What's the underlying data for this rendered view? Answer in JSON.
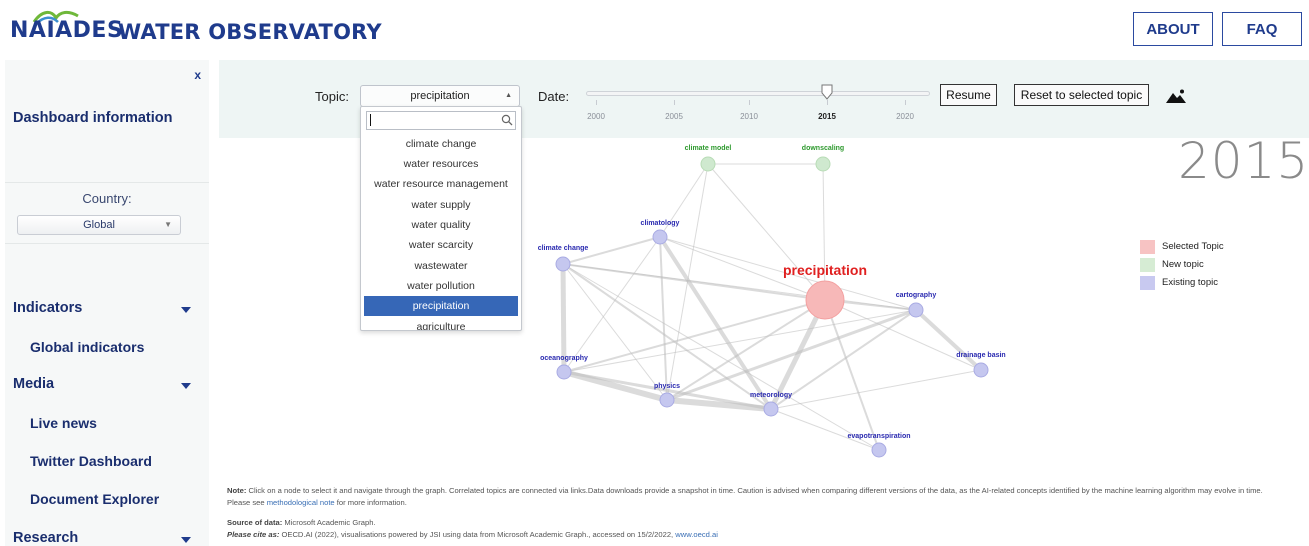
{
  "header": {
    "logo_text": "NAIADES",
    "title": "WATER OBSERVATORY",
    "about_label": "ABOUT",
    "faq_label": "FAQ"
  },
  "sidebar": {
    "close_label": "x",
    "dashboard_info": "Dashboard information",
    "country_label": "Country:",
    "country_value": "Global",
    "sections": [
      {
        "label": "Indicators",
        "items": [
          "Global indicators"
        ]
      },
      {
        "label": "Media",
        "items": [
          "Live news",
          "Twitter Dashboard",
          "Document Explorer"
        ]
      },
      {
        "label": "Research",
        "items": []
      }
    ]
  },
  "controls": {
    "topic_label": "Topic:",
    "topic_value": "precipitation",
    "date_label": "Date:",
    "ticks": [
      "2000",
      "2005",
      "2010",
      "2015",
      "2020"
    ],
    "selected_year": "2015",
    "resume_label": "Resume",
    "reset_label": "Reset to selected topic",
    "export_icon": "mountain-image-icon"
  },
  "dropdown": {
    "search_value": "",
    "options": [
      "climate change",
      "water resources",
      "water resource management",
      "water supply",
      "water quality",
      "water scarcity",
      "wastewater",
      "water pollution",
      "precipitation",
      "agriculture"
    ],
    "selected": "precipitation"
  },
  "graph": {
    "year": "2015",
    "selected_topic": "precipitation",
    "new_topics": [
      "climate model",
      "downscaling"
    ],
    "existing_topics": [
      "climatology",
      "climate change",
      "cartography",
      "oceanography",
      "drainage basin",
      "physics",
      "meteorology",
      "evapotranspiration"
    ],
    "colors": {
      "selected": "#f7b8b8",
      "new": "#cfe9cf",
      "existing": "#c5c7ef",
      "new_text": "#2e9a2e",
      "existing_text": "#2a2ab0",
      "selected_text": "#e02020"
    }
  },
  "legend": [
    {
      "label": "Selected Topic",
      "color": "#f7c3c3"
    },
    {
      "label": "New topic",
      "color": "#d6ecd4"
    },
    {
      "label": "Existing topic",
      "color": "#c8c9f0"
    }
  ],
  "notes": {
    "note_label": "Note:",
    "note_text": "Click on a node to select it and navigate through the graph. Correlated topics are connected via links.Data downloads provide a snapshot in time. Caution is advised when comparing different versions of the data, as the AI-related concepts identified by the machine learning algorithm may evolve in time.",
    "see_prefix": "Please see ",
    "see_link": "methodological note",
    "see_suffix": " for more information.",
    "source_label": "Source of data:",
    "source_text": " Microsoft Academic Graph.",
    "cite_label": "Please cite as:",
    "cite_text": " OECD.AI (2022), visualisations powered by JSI using data from Microsoft Academic Graph., accessed on 15/2/2022, ",
    "cite_link": "www.oecd.ai"
  }
}
